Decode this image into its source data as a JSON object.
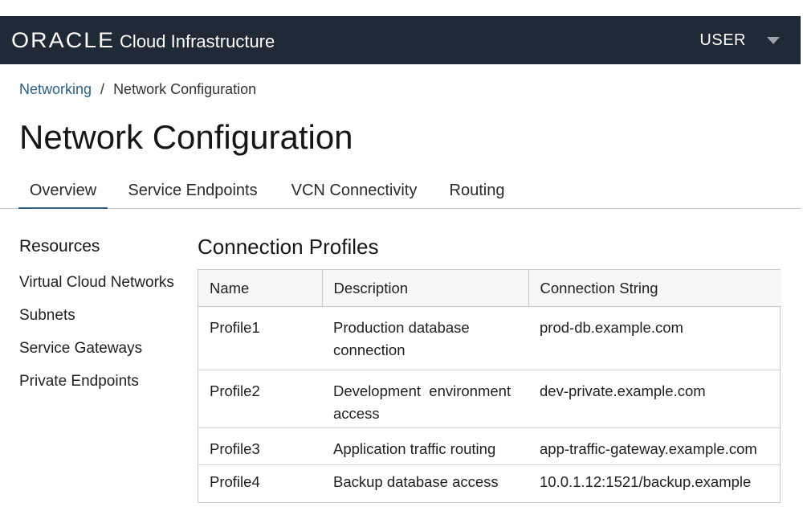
{
  "header": {
    "brand_oracle": "ORACLE",
    "brand_product": "Cloud Infrastructure",
    "user_label": "USER",
    "background": "#1f2a36"
  },
  "breadcrumb": {
    "parent": "Networking",
    "separator": "/",
    "current": "Network Configuration"
  },
  "page_title": "Network Configuration",
  "tabs": [
    {
      "label": "Overview",
      "active": true
    },
    {
      "label": "Service Endpoints",
      "active": false
    },
    {
      "label": "VCN Connectivity",
      "active": false
    },
    {
      "label": "Routing",
      "active": false
    }
  ],
  "sidebar": {
    "title": "Resources",
    "items": [
      {
        "label": "Virtual Cloud Networks"
      },
      {
        "label": "Subnets"
      },
      {
        "label": "Service Gateways"
      },
      {
        "label": "Private Endpoints"
      }
    ]
  },
  "profiles": {
    "title": "Connection Profiles",
    "columns": [
      "Name",
      "Description",
      "Connection String"
    ],
    "rows": [
      {
        "name": "Profile1",
        "description": "Production database connection",
        "connection": "prod-db.example.com"
      },
      {
        "name": "Profile2",
        "description": "Development  environment access",
        "connection": "dev-private.example.com"
      },
      {
        "name": "Profile3",
        "description": "Application traffic routing",
        "connection": "app-traffic-gateway.example.com"
      },
      {
        "name": "Profile4",
        "description": "Backup database access",
        "connection": "10.0.1.12:1521/backup.example"
      }
    ]
  },
  "colors": {
    "accent": "#2d5f8b",
    "header_bg": "#1f2a36"
  },
  "icons": {
    "user_menu": "chevron-down-icon"
  }
}
